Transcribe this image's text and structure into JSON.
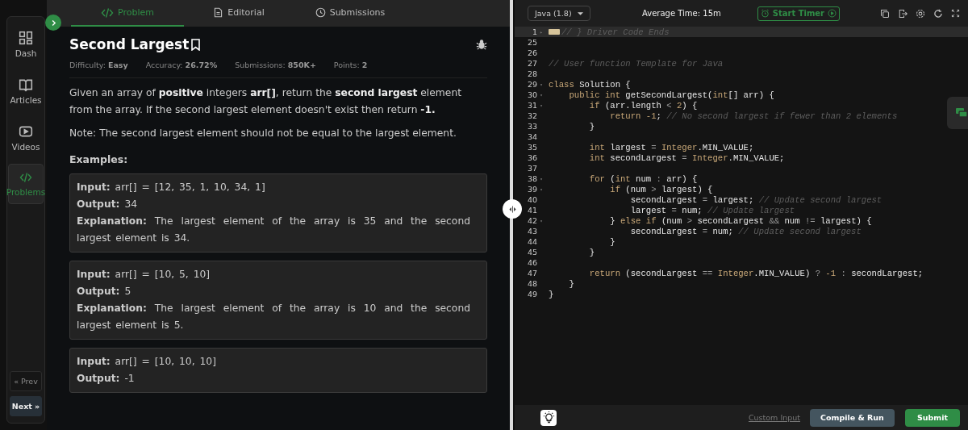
{
  "nav": {
    "items": [
      {
        "label": "Dash",
        "selected": false
      },
      {
        "label": "Articles",
        "selected": false
      },
      {
        "label": "Videos",
        "selected": false
      },
      {
        "label": "Problems",
        "selected": true
      }
    ],
    "prev": "« Prev",
    "next": "Next »"
  },
  "tabs": [
    {
      "label": "Problem",
      "selected": true
    },
    {
      "label": "Editorial",
      "selected": false
    },
    {
      "label": "Submissions",
      "selected": false
    }
  ],
  "problem": {
    "title": "Second Largest",
    "meta": [
      {
        "label": "Difficulty:",
        "value": "Easy"
      },
      {
        "label": "Accuracy:",
        "value": "26.72%"
      },
      {
        "label": "Submissions:",
        "value": "850K+"
      },
      {
        "label": "Points:",
        "value": "2"
      }
    ],
    "paragraphs": [
      "Given an array of **positive** integers **arr[]**, return the **second largest** element from the array. If the second largest element doesn't exist then return **-1.**",
      "Note: The second largest element should not be equal to the largest element."
    ],
    "examples_heading": "Examples:",
    "examples": [
      [
        {
          "label": "Input:",
          "value": "arr[] = [12, 35, 1, 10, 34, 1]"
        },
        {
          "label": "Output:",
          "value": "34"
        },
        {
          "label": "Explanation:",
          "value": "The largest element of the array is 35 and the second largest element is 34."
        }
      ],
      [
        {
          "label": "Input:",
          "value": "arr[] = [10, 5, 10]"
        },
        {
          "label": "Output:",
          "value": "5"
        },
        {
          "label": "Explanation:",
          "value": "The largest element of the array is 10 and the second largest element is 5."
        }
      ],
      [
        {
          "label": "Input:",
          "value": "arr[] = [10, 10, 10]"
        },
        {
          "label": "Output:",
          "value": "-1"
        }
      ]
    ]
  },
  "editor": {
    "language": "Java (1.8)",
    "average_time": "Average Time: 15m",
    "timer_button": "Start Timer",
    "lines": [
      {
        "number": "1",
        "fold_marker": "▸",
        "highlighted": true,
        "tokens": [
          {
            "kind": "cm",
            "text": "// } Driver Code Ends"
          }
        ]
      },
      {
        "number": "25",
        "highlighted": false
      },
      {
        "number": "26",
        "highlighted": false
      },
      {
        "number": "27",
        "highlighted": false,
        "tokens": [
          {
            "kind": "cm",
            "text": "// User function Template for Java"
          }
        ]
      },
      {
        "number": "28",
        "highlighted": false
      },
      {
        "number": "29",
        "fold_marker": "▾",
        "highlighted": false,
        "tokens": [
          {
            "kind": "kw",
            "text": "class"
          },
          {
            "kind": "plain",
            "text": " Solution {"
          }
        ]
      },
      {
        "number": "30",
        "fold_marker": "▾",
        "highlighted": false,
        "tokens": [
          {
            "kind": "kw",
            "text": "    public int"
          },
          {
            "kind": "plain",
            "text": " getSecondLargest("
          },
          {
            "kind": "kw",
            "text": "int"
          },
          {
            "kind": "plain",
            "text": "[] arr) {"
          }
        ]
      },
      {
        "number": "31",
        "fold_marker": "▾",
        "highlighted": false,
        "tokens": [
          {
            "kind": "kw",
            "text": "        if"
          },
          {
            "kind": "plain",
            "text": " (arr.length "
          },
          {
            "kind": "op",
            "text": "< "
          },
          {
            "kind": "kw",
            "text": "2"
          },
          {
            "kind": "plain",
            "text": ") {"
          }
        ]
      },
      {
        "number": "32",
        "highlighted": false,
        "tokens": [
          {
            "kind": "kw",
            "text": "            return -1"
          },
          {
            "kind": "plain",
            "text": "; "
          },
          {
            "kind": "cm",
            "text": "// No second largest if fewer than 2 elements"
          }
        ]
      },
      {
        "number": "33",
        "highlighted": false,
        "tokens": [
          {
            "kind": "plain",
            "text": "        }"
          }
        ]
      },
      {
        "number": "34",
        "highlighted": false
      },
      {
        "number": "35",
        "highlighted": false,
        "tokens": [
          {
            "kind": "kw",
            "text": "        int"
          },
          {
            "kind": "plain",
            "text": " largest "
          },
          {
            "kind": "op",
            "text": "= "
          },
          {
            "kind": "kw",
            "text": "Integer"
          },
          {
            "kind": "plain",
            "text": ".MIN_VALUE;"
          }
        ]
      },
      {
        "number": "36",
        "highlighted": false,
        "tokens": [
          {
            "kind": "kw",
            "text": "        int"
          },
          {
            "kind": "plain",
            "text": " secondLargest "
          },
          {
            "kind": "op",
            "text": "= "
          },
          {
            "kind": "kw",
            "text": "Integer"
          },
          {
            "kind": "plain",
            "text": ".MIN_VALUE;"
          }
        ]
      },
      {
        "number": "37",
        "highlighted": false
      },
      {
        "number": "38",
        "fold_marker": "▾",
        "highlighted": false,
        "tokens": [
          {
            "kind": "kw",
            "text": "        for"
          },
          {
            "kind": "plain",
            "text": " ("
          },
          {
            "kind": "kw",
            "text": "int"
          },
          {
            "kind": "plain",
            "text": " num "
          },
          {
            "kind": "op",
            "text": ": "
          },
          {
            "kind": "plain",
            "text": "arr) {"
          }
        ]
      },
      {
        "number": "39",
        "fold_marker": "▾",
        "highlighted": false,
        "tokens": [
          {
            "kind": "kw",
            "text": "            if"
          },
          {
            "kind": "plain",
            "text": " (num "
          },
          {
            "kind": "op",
            "text": "> "
          },
          {
            "kind": "plain",
            "text": "largest) {"
          }
        ]
      },
      {
        "number": "40",
        "highlighted": false,
        "tokens": [
          {
            "kind": "plain",
            "text": "                secondLargest "
          },
          {
            "kind": "op",
            "text": "= "
          },
          {
            "kind": "plain",
            "text": "largest; "
          },
          {
            "kind": "cm",
            "text": "// Update second largest"
          }
        ]
      },
      {
        "number": "41",
        "highlighted": false,
        "tokens": [
          {
            "kind": "plain",
            "text": "                largest "
          },
          {
            "kind": "op",
            "text": "= "
          },
          {
            "kind": "plain",
            "text": "num; "
          },
          {
            "kind": "cm",
            "text": "// Update largest"
          }
        ]
      },
      {
        "number": "42",
        "fold_marker": "▾",
        "highlighted": false,
        "tokens": [
          {
            "kind": "plain",
            "text": "            } "
          },
          {
            "kind": "kw",
            "text": "else if"
          },
          {
            "kind": "plain",
            "text": " (num "
          },
          {
            "kind": "op",
            "text": "> "
          },
          {
            "kind": "plain",
            "text": "secondLargest "
          },
          {
            "kind": "op",
            "text": "&& "
          },
          {
            "kind": "plain",
            "text": "num "
          },
          {
            "kind": "op",
            "text": "!= "
          },
          {
            "kind": "plain",
            "text": "largest) {"
          }
        ]
      },
      {
        "number": "43",
        "highlighted": false,
        "tokens": [
          {
            "kind": "plain",
            "text": "                secondLargest "
          },
          {
            "kind": "op",
            "text": "= "
          },
          {
            "kind": "plain",
            "text": "num; "
          },
          {
            "kind": "cm",
            "text": "// Update second largest"
          }
        ]
      },
      {
        "number": "44",
        "highlighted": false,
        "tokens": [
          {
            "kind": "plain",
            "text": "            }"
          }
        ]
      },
      {
        "number": "45",
        "highlighted": false,
        "tokens": [
          {
            "kind": "plain",
            "text": "        }"
          }
        ]
      },
      {
        "number": "46",
        "highlighted": false
      },
      {
        "number": "47",
        "highlighted": false,
        "tokens": [
          {
            "kind": "kw",
            "text": "        return"
          },
          {
            "kind": "plain",
            "text": " (secondLargest "
          },
          {
            "kind": "op",
            "text": "== "
          },
          {
            "kind": "kw",
            "text": "Integer"
          },
          {
            "kind": "plain",
            "text": ".MIN_VALUE) "
          },
          {
            "kind": "op",
            "text": "? "
          },
          {
            "kind": "kw",
            "text": "-1 "
          },
          {
            "kind": "op",
            "text": ": "
          },
          {
            "kind": "plain",
            "text": "secondLargest;"
          }
        ]
      },
      {
        "number": "48",
        "highlighted": false,
        "tokens": [
          {
            "kind": "plain",
            "text": "    }"
          }
        ]
      },
      {
        "number": "49",
        "highlighted": false,
        "tokens": [
          {
            "kind": "plain",
            "text": "}"
          }
        ]
      }
    ]
  },
  "footer": {
    "custom_input": "Custom Input",
    "compile": "Compile & Run",
    "submit": "Submit"
  }
}
